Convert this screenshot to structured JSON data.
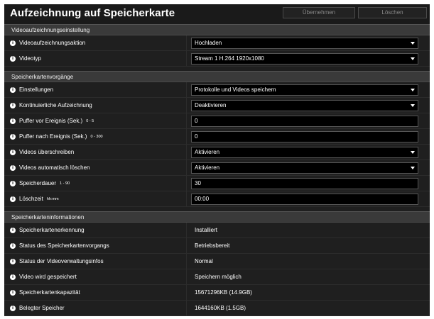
{
  "header": {
    "title": "Aufzeichnung auf Speicherkarte",
    "apply_label": "Übernehmen",
    "delete_label": "Löschen"
  },
  "video_settings": {
    "section_title": "Videoaufzeichnungseinstellung",
    "rows": [
      {
        "label": "Videoaufzeichnungsaktion",
        "value": "Hochladen"
      },
      {
        "label": "Videotyp",
        "value": "Stream 1 H.264 1920x1080"
      }
    ]
  },
  "card_operations": {
    "section_title": "Speicherkartenvorgänge",
    "rows": [
      {
        "label": "Einstellungen",
        "value": "Protokolle und Videos speichern"
      },
      {
        "label": "Kontinuierliche Aufzeichnung",
        "value": "Deaktivieren"
      },
      {
        "label": "Puffer vor Ereignis (Sek.)",
        "range": "0 - 5",
        "value": "0"
      },
      {
        "label": "Puffer nach Ereignis (Sek.)",
        "range": "0 - 300",
        "value": "0"
      },
      {
        "label": "Videos überschreiben",
        "value": "Aktivieren"
      },
      {
        "label": "Videos automatisch löschen",
        "value": "Aktivieren"
      },
      {
        "label": "Speicherdauer",
        "range": "1 - 90",
        "value": "30"
      },
      {
        "label": "Löschzeit",
        "range": "hh:mm",
        "value": "00:00"
      }
    ]
  },
  "card_info": {
    "section_title": "Speicherkarteninformationen",
    "rows": [
      {
        "label": "Speicherkartenerkennung",
        "value": "Installiert"
      },
      {
        "label": "Status des Speicherkartenvorgangs",
        "value": "Betriebsbereit"
      },
      {
        "label": "Status der Videoverwaltungsinfos",
        "value": "Normal"
      },
      {
        "label": "Video wird gespeichert",
        "value": "Speichern möglich"
      },
      {
        "label": "Speicherkartenkapazität",
        "value": "15671296KB (14.9GB)"
      },
      {
        "label": "Belegter Speicher",
        "value": "1644160KB (1.5GB)"
      }
    ]
  }
}
